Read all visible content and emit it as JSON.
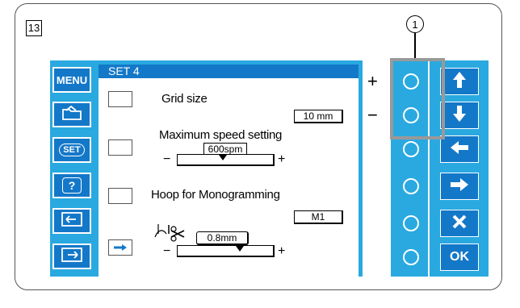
{
  "step_number": "13",
  "callout_number": "1",
  "menu": {
    "menu_label": "MENU",
    "set_label": "SET",
    "help_label": "?"
  },
  "screen": {
    "title": "SET 4",
    "grid_size": {
      "label": "Grid size",
      "value": "10 mm"
    },
    "max_speed": {
      "label": "Maximum speed setting",
      "value": "600spm",
      "minus": "−",
      "plus": "+"
    },
    "hoop": {
      "label": "Hoop for Monogramming",
      "value": "M1"
    },
    "thread_cut": {
      "value": "0.8mm",
      "minus": "−",
      "plus": "+"
    }
  },
  "side_controls": {
    "plus": "+",
    "minus": "−"
  },
  "nav": {
    "ok_label": "OK"
  },
  "colors": {
    "panel": "#29a9e0",
    "button": "#1478c9",
    "highlight": "#999999"
  }
}
